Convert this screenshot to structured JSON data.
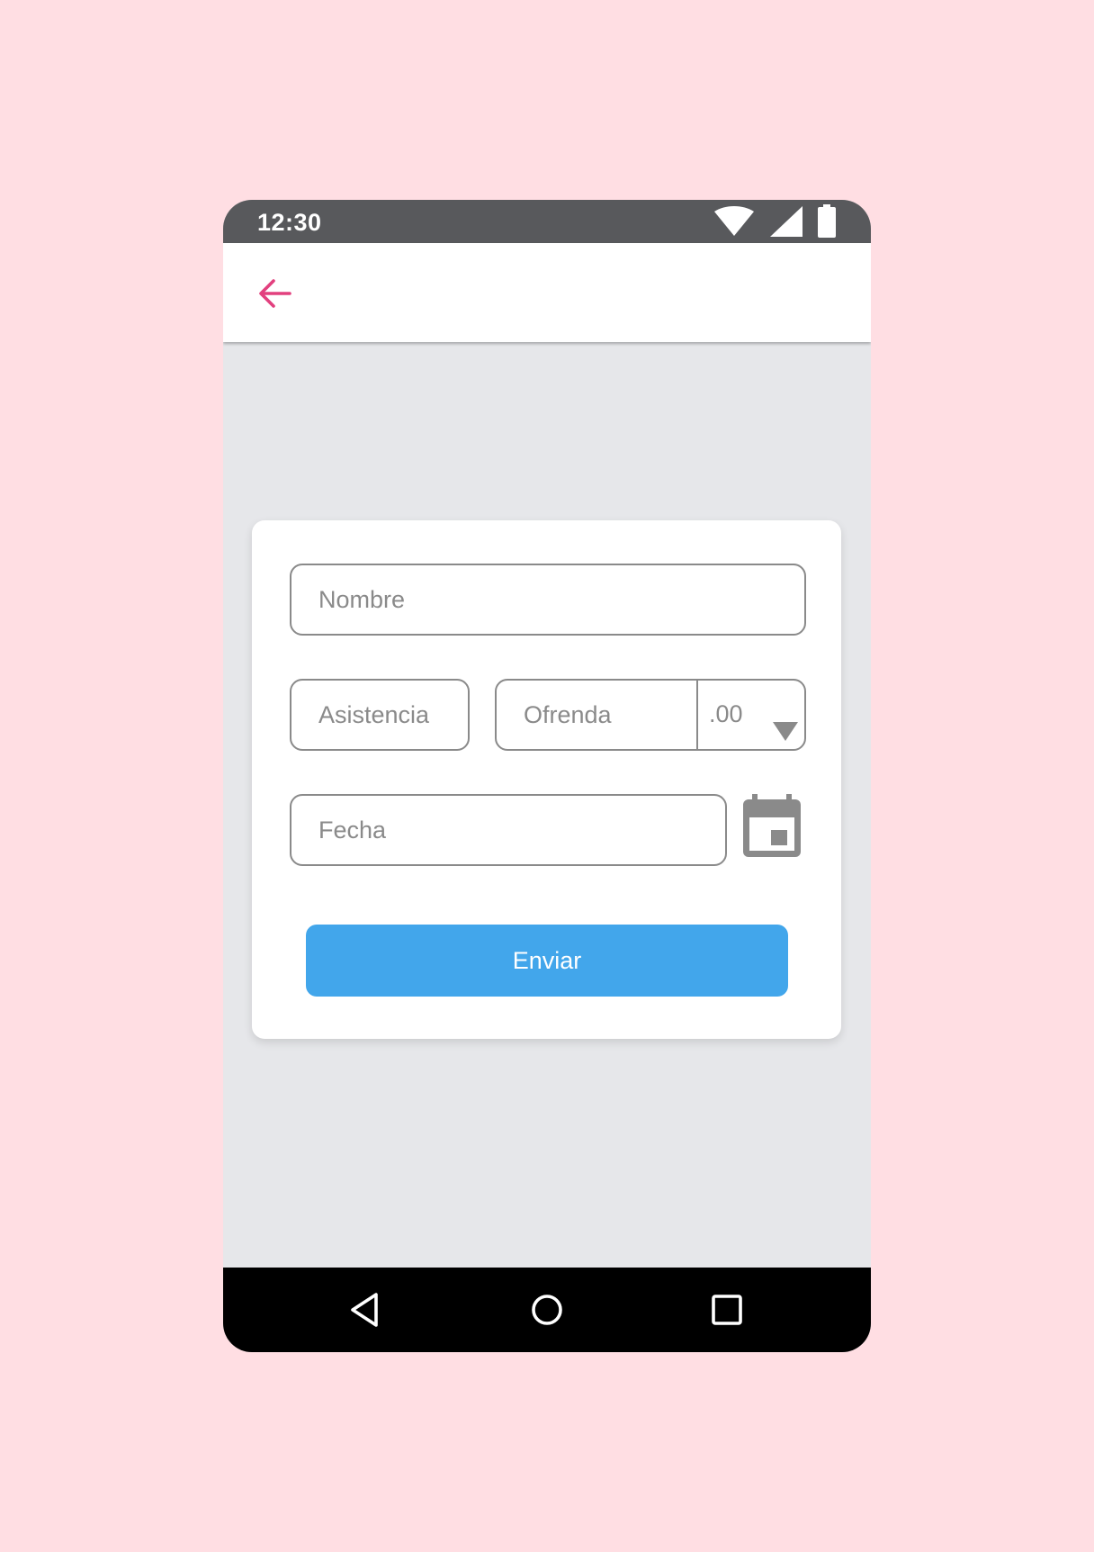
{
  "colors": {
    "page_background": "#ffdee3",
    "status_bar": "#58595c",
    "app_bar": "#ffffff",
    "content_background": "#e6e7ea",
    "accent_back_arrow": "#e2407e",
    "field_border": "#8a8a8a",
    "primary_button": "#42a6eb",
    "nav_bar": "#000000"
  },
  "status_bar": {
    "time": "12:30",
    "icons": [
      "wifi-icon",
      "signal-icon",
      "battery-icon"
    ]
  },
  "app_bar": {
    "back_icon": "arrow-left-icon"
  },
  "form": {
    "nombre": {
      "placeholder": "Nombre",
      "value": ""
    },
    "asistencia": {
      "placeholder": "Asistencia",
      "value": ""
    },
    "ofrenda": {
      "placeholder": "Ofrenda",
      "value": ""
    },
    "decimal": {
      "selected": ".00"
    },
    "fecha": {
      "placeholder": "Fecha",
      "value": ""
    },
    "calendar_icon": "calendar-icon",
    "submit_label": "Enviar"
  },
  "nav_bar": {
    "icons": [
      "nav-back-icon",
      "nav-home-icon",
      "nav-recents-icon"
    ]
  }
}
